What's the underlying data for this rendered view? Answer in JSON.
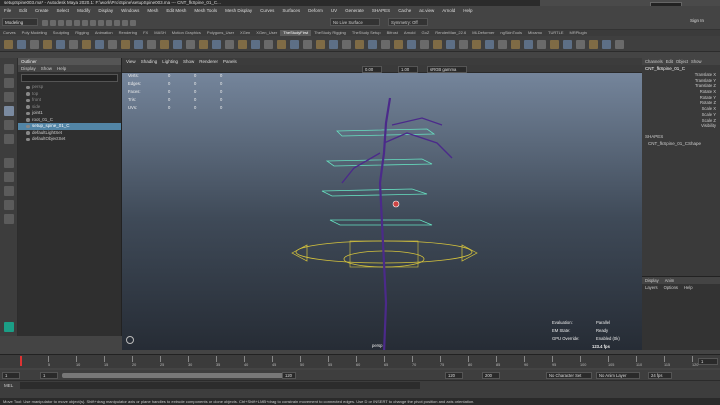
{
  "window": {
    "title": "setupSpine003.ma* - Autodesk Maya 2020.1: F:\\work\\Pro\\Spine\\setupSpine003.ma --- CNT_fkSpine_01_C..."
  },
  "menubar": [
    "File",
    "Edit",
    "Create",
    "Select",
    "Modify",
    "Display",
    "Windows",
    "Mesh",
    "Edit Mesh",
    "Mesh Tools",
    "Mesh Display",
    "Curves",
    "Surfaces",
    "Deform",
    "UV",
    "Generate",
    "SHAPES",
    "Cache",
    "ac.view",
    "Arnold",
    "Help"
  ],
  "status": {
    "mode": "Modeling",
    "live_surface": "No Live Surface",
    "symmetry": "Symmetry: Off",
    "sign_in": "Sign In",
    "rec_time": "00:00:04"
  },
  "shelf_tabs": [
    {
      "label": "Curves",
      "active": false
    },
    {
      "label": "Poly Modeling",
      "active": false
    },
    {
      "label": "Sculpting",
      "active": false
    },
    {
      "label": "Rigging",
      "active": false
    },
    {
      "label": "Animation",
      "active": false
    },
    {
      "label": "Rendering",
      "active": false
    },
    {
      "label": "FX",
      "active": false
    },
    {
      "label": "MASH",
      "active": false
    },
    {
      "label": "Motion Graphics",
      "active": false
    },
    {
      "label": "Polygons_User",
      "active": false
    },
    {
      "label": "XGen",
      "active": false
    },
    {
      "label": "XGen_User",
      "active": false
    },
    {
      "label": "TheStudyFirst",
      "active": true
    },
    {
      "label": "TheStudy Rigging",
      "active": false
    },
    {
      "label": "TheStudy Setup",
      "active": false
    },
    {
      "label": "Bifrost",
      "active": false
    },
    {
      "label": "Arnold",
      "active": false
    },
    {
      "label": "GoZ",
      "active": false
    },
    {
      "label": "RenderMan_22.6",
      "active": false
    },
    {
      "label": "MLDeformer",
      "active": false
    },
    {
      "label": "ngSkinTools",
      "active": false
    },
    {
      "label": "Mixamo",
      "active": false
    },
    {
      "label": "TURTLE",
      "active": false
    },
    {
      "label": "MRPlugin",
      "active": false
    }
  ],
  "outliner": {
    "title": "Outliner",
    "menu": [
      "Display",
      "Show",
      "Help"
    ],
    "items": [
      {
        "label": "persp",
        "style": "dim"
      },
      {
        "label": "top",
        "style": "dim"
      },
      {
        "label": "front",
        "style": "dim"
      },
      {
        "label": "side",
        "style": "dim"
      },
      {
        "label": "joint1",
        "style": "normal"
      },
      {
        "label": "root_01_C",
        "style": "normal"
      },
      {
        "label": "setup_spine_01_C",
        "style": "sel"
      },
      {
        "label": "defaultLightSet",
        "style": "normal"
      },
      {
        "label": "defaultObjectSet",
        "style": "normal"
      }
    ]
  },
  "viewport": {
    "menu": [
      "View",
      "Shading",
      "Lighting",
      "Show",
      "Renderer",
      "Panels"
    ],
    "hud_stats": [
      {
        "label": "Verts:",
        "v1": "0",
        "v2": "0",
        "v3": "0"
      },
      {
        "label": "Edges:",
        "v1": "0",
        "v2": "0",
        "v3": "0"
      },
      {
        "label": "Faces:",
        "v1": "0",
        "v2": "0",
        "v3": "0"
      },
      {
        "label": "Tris:",
        "v1": "0",
        "v2": "0",
        "v3": "0"
      },
      {
        "label": "UVs:",
        "v1": "0",
        "v2": "0",
        "v3": "0"
      }
    ],
    "field_1": "0.00",
    "field_2": "1.00",
    "colorspace": "sRGB gamma",
    "camera": "persp",
    "eval": [
      {
        "label": "Evaluation:",
        "value": "Parallel"
      },
      {
        "label": "EM State:",
        "value": "Ready"
      },
      {
        "label": "GPU Override:",
        "value": "Enabled (0k)"
      }
    ],
    "fps": "123.4 fps"
  },
  "channelbox": {
    "tabs": [
      "Channels",
      "Edit",
      "Object",
      "Show"
    ],
    "object": "CNT_fkSpine_01_C",
    "attrs": [
      "Translate X",
      "Translate Y",
      "Translate Z",
      "Rotate X",
      "Rotate Y",
      "Rotate Z",
      "Scale X",
      "Scale Y",
      "Scale Z",
      "Visibility"
    ],
    "shapes_title": "SHAPES",
    "shape": "CNT_fkSpine_01_CShape"
  },
  "layers": {
    "tabs": [
      "Display",
      "Anim"
    ],
    "menu": [
      "Layers",
      "Options",
      "Help"
    ]
  },
  "timeslider": {
    "ticks": [
      "5",
      "10",
      "15",
      "20",
      "25",
      "30",
      "35",
      "40",
      "45",
      "50",
      "55",
      "60",
      "65",
      "70",
      "75",
      "80",
      "85",
      "90",
      "95",
      "100",
      "105",
      "110",
      "115",
      "120"
    ],
    "current": "1"
  },
  "range": {
    "start": "1",
    "inner_start": "1",
    "inner_end": "120",
    "end": "120",
    "max": "200",
    "char_set": "No Character Set",
    "anim_layer": "No Anim Layer",
    "fps": "24 fps"
  },
  "mel": {
    "label": "MEL"
  },
  "helpline": "Move Tool: Use manipulator to move object(s). Shift+drag manipulator axis or plane handles to extrude components or clone objects. Ctrl+Shift+LMB+drag to constrain movement to connected edges. Use D or INSERT to change the pivot position and axis orientation."
}
